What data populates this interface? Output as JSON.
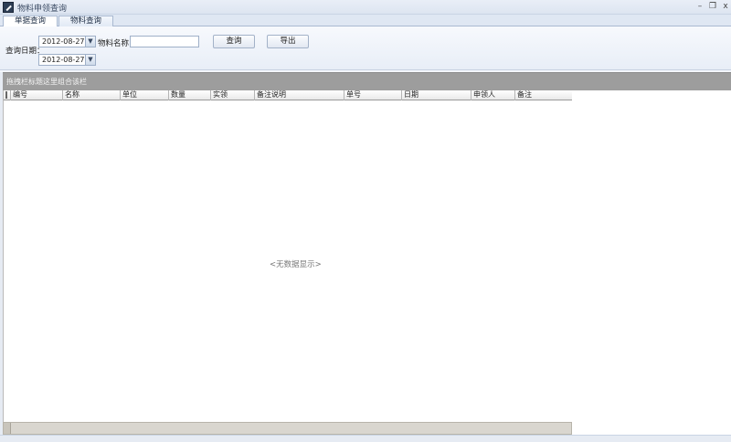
{
  "window": {
    "title": "物料申领查询",
    "minimize": "–",
    "restore": "❐",
    "close": "x"
  },
  "tabs": [
    {
      "label": "单据查询",
      "active": true
    },
    {
      "label": "物料查询",
      "active": false
    }
  ],
  "filter": {
    "date_label": "查询日期：",
    "date_from": "2012-08-27",
    "date_to": "2012-08-27",
    "dropdown_glyph": "▼",
    "material_label": "物料名称：",
    "material_value": "",
    "query_button": "查询",
    "export_button": "导出"
  },
  "group_panel": {
    "hint": "拖拽栏标题这里组合该栏"
  },
  "grid": {
    "indicator": "‖",
    "columns": [
      "编号",
      "名称",
      "单位",
      "数量",
      "实领",
      "备注说明",
      "单号",
      "日期",
      "申领人",
      "备注"
    ],
    "rows": [],
    "empty_text": "<无数据显示>"
  }
}
